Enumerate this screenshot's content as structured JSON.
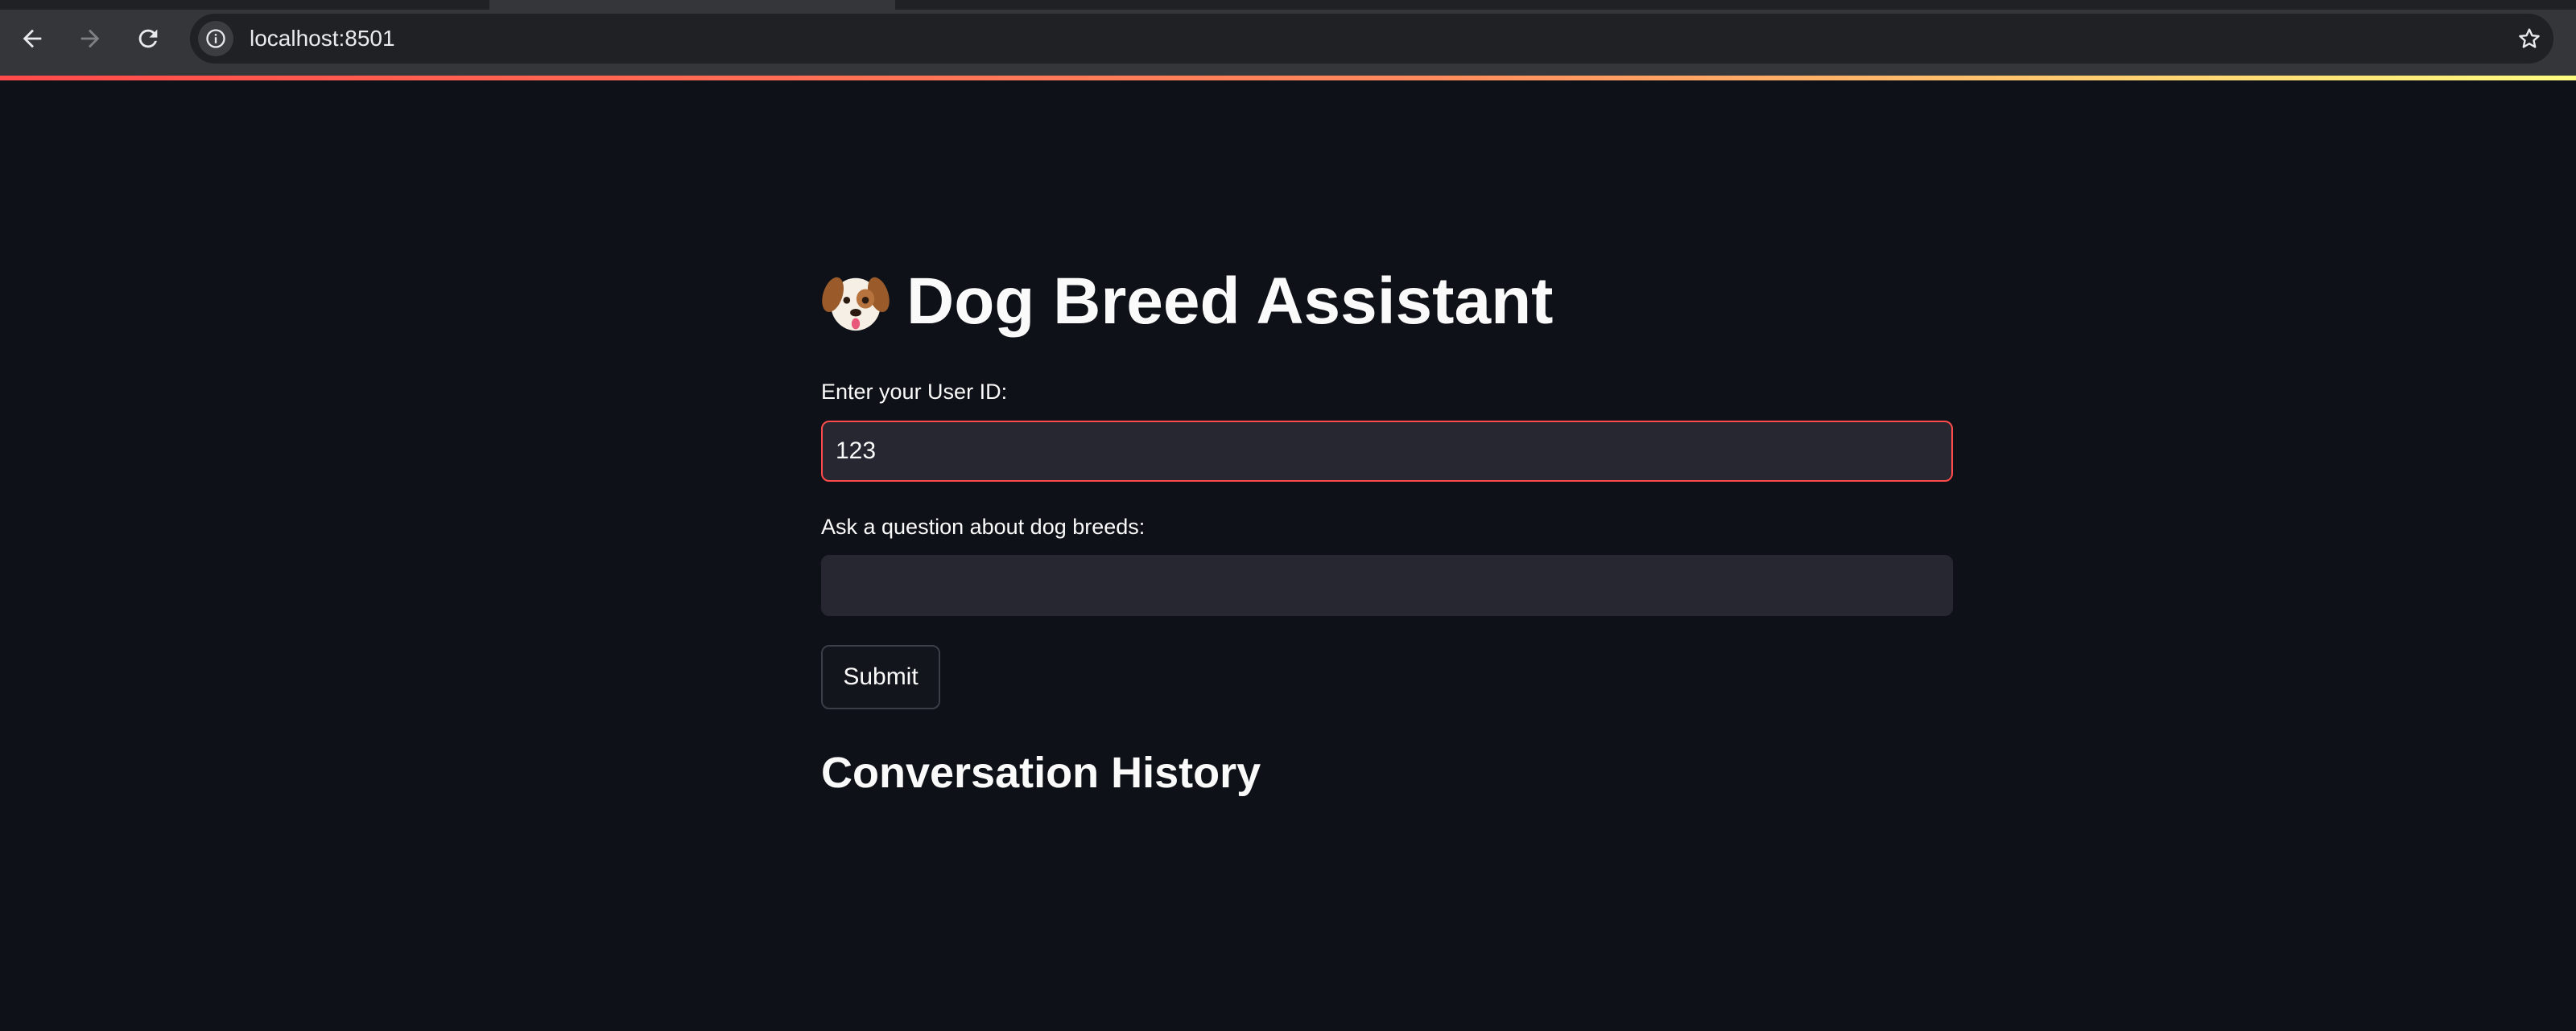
{
  "browser": {
    "url": "localhost:8501",
    "icons": [
      "back-arrow-icon",
      "forward-arrow-icon",
      "reload-icon",
      "site-info-icon",
      "bookmark-star-icon"
    ]
  },
  "theme": {
    "background": "#0e1117",
    "input_background": "#262730",
    "accent": "#ff4b4b",
    "text": "#fafafa"
  },
  "app": {
    "title_icon": "dog-face-emoji",
    "title": "Dog Breed Assistant",
    "user_id": {
      "label": "Enter your User ID:",
      "value": "123"
    },
    "question": {
      "label": "Ask a question about dog breeds:",
      "value": ""
    },
    "submit_label": "Submit",
    "history_heading": "Conversation History"
  }
}
